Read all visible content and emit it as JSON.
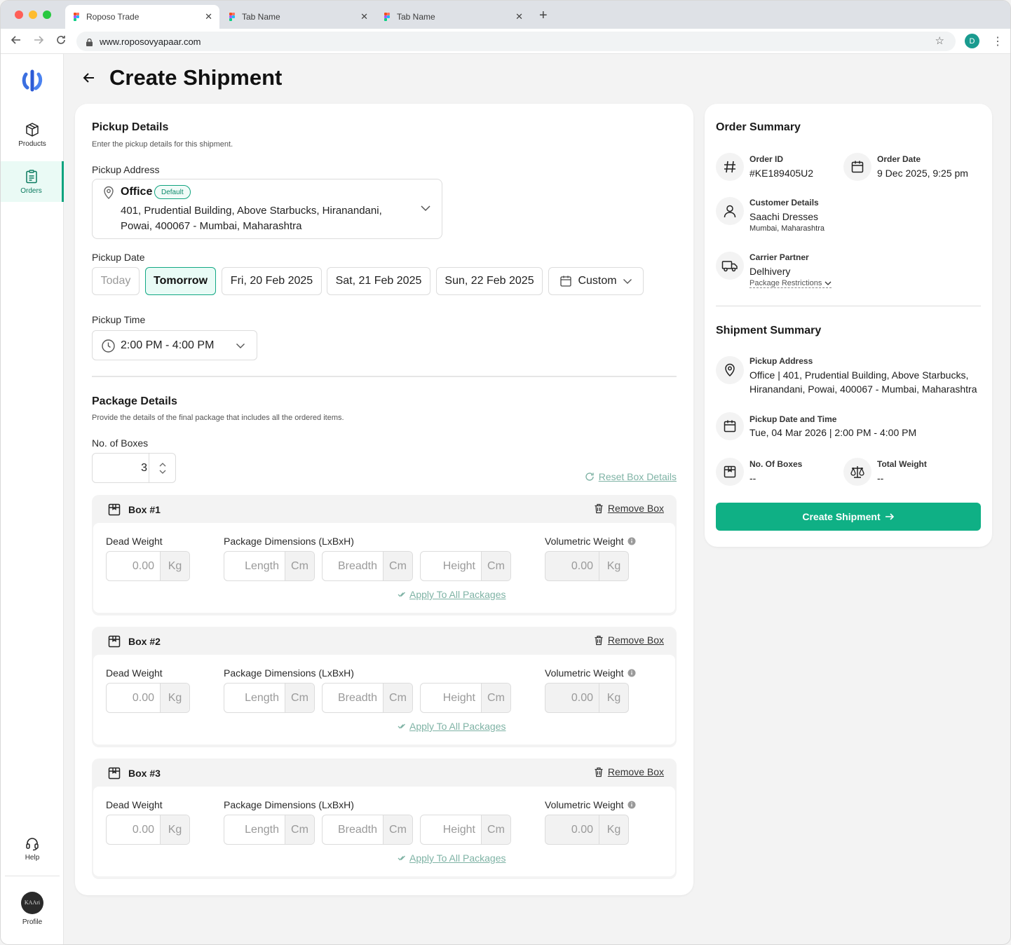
{
  "browser": {
    "tabs": [
      {
        "label": "Roposo Trade",
        "active": true
      },
      {
        "label": "Tab Name",
        "active": false
      },
      {
        "label": "Tab Name",
        "active": false
      }
    ],
    "url": "www.roposovyapaar.com",
    "profile_initial": "D"
  },
  "sidebar": {
    "items": [
      {
        "label": "Products",
        "icon": "box-icon",
        "active": false
      },
      {
        "label": "Orders",
        "icon": "clipboard-icon",
        "active": true
      }
    ],
    "help_label": "Help",
    "profile_label": "Profile",
    "profile_logo_text": "KAAri"
  },
  "page": {
    "title": "Create Shipment"
  },
  "pickup": {
    "title": "Pickup Details",
    "subtitle": "Enter the pickup details for this shipment.",
    "address_label": "Pickup Address",
    "address_name": "Office",
    "address_badge": "Default",
    "address_line": "401, Prudential Building, Above Starbucks, Hiranandani, Powai, 400067 - Mumbai, Maharashtra",
    "date_label": "Pickup Date",
    "date_options": [
      {
        "label": "Today",
        "state": "disabled"
      },
      {
        "label": "Tomorrow",
        "state": "selected"
      },
      {
        "label": "Fri, 20 Feb 2025",
        "state": "normal"
      },
      {
        "label": "Sat, 21 Feb 2025",
        "state": "normal"
      },
      {
        "label": "Sun, 22 Feb 2025",
        "state": "normal"
      }
    ],
    "custom_label": "Custom",
    "time_label": "Pickup Time",
    "time_value": "2:00 PM - 4:00 PM"
  },
  "package": {
    "title": "Package Details",
    "subtitle": "Provide the details of the final package that includes all the ordered items.",
    "boxes_label": "No. of Boxes",
    "boxes_value": "3",
    "reset_label": "Reset Box Details",
    "remove_label": "Remove Box",
    "dead_weight_label": "Dead Weight",
    "dimensions_label": "Package Dimensions  (LxBxH)",
    "volumetric_label": "Volumetric Weight",
    "weight_placeholder": "0.00",
    "weight_unit": "Kg",
    "length_placeholder": "Length",
    "breadth_placeholder": "Breadth",
    "height_placeholder": "Height",
    "dim_unit": "Cm",
    "volumetric_value": "0.00",
    "apply_label": "Apply To All Packages",
    "boxes": [
      {
        "title": "Box #1"
      },
      {
        "title": "Box #2"
      },
      {
        "title": "Box #3"
      }
    ]
  },
  "order_summary": {
    "title": "Order Summary",
    "order_id_label": "Order ID",
    "order_id": "#KE189405U2",
    "order_date_label": "Order Date",
    "order_date": "9 Dec 2025, 9:25 pm",
    "customer_label": "Customer Details",
    "customer_name": "Saachi Dresses",
    "customer_location": "Mumbai, Maharashtra",
    "carrier_label": "Carrier Partner",
    "carrier_name": "Delhivery",
    "restrictions_label": "Package Restrictions"
  },
  "shipment_summary": {
    "title": "Shipment Summary",
    "pickup_address_label": "Pickup Address",
    "pickup_address": "Office | 401, Prudential Building, Above Starbucks, Hiranandani, Powai, 400067 - Mumbai, Maharashtra",
    "pickup_datetime_label": "Pickup Date and Time",
    "pickup_datetime": "Tue, 04 Mar 2026 |  2:00 PM - 4:00 PM",
    "boxes_label": "No. Of Boxes",
    "boxes_value": "--",
    "weight_label": "Total Weight",
    "weight_value": "--",
    "create_button": "Create Shipment"
  },
  "colors": {
    "accent": "#0fb085",
    "selected_bg": "#e9fbf6",
    "link_muted": "#7fb3a5"
  }
}
